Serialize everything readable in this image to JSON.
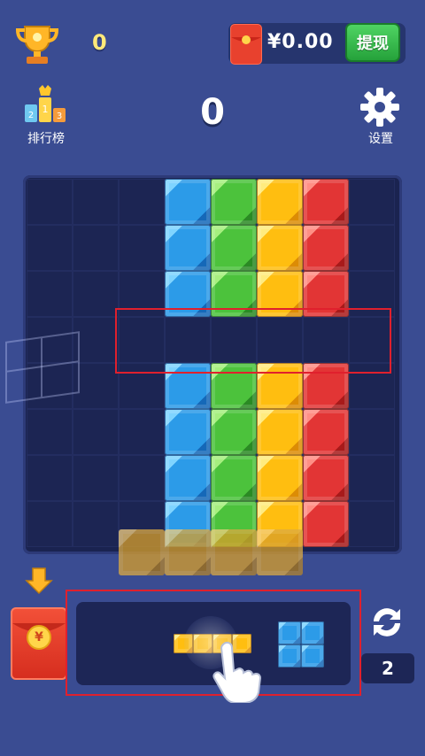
{
  "header": {
    "trophy_score": "0",
    "money": "¥0.00",
    "withdraw_label": "提现",
    "rank_label": "排行榜",
    "center_score": "0",
    "settings_label": "设置"
  },
  "board": {
    "cols": 8,
    "rows": 8,
    "blocks": [
      {
        "c": 3,
        "r": 0,
        "color": "blue"
      },
      {
        "c": 4,
        "r": 0,
        "color": "green"
      },
      {
        "c": 5,
        "r": 0,
        "color": "yellow"
      },
      {
        "c": 6,
        "r": 0,
        "color": "red"
      },
      {
        "c": 3,
        "r": 1,
        "color": "blue"
      },
      {
        "c": 4,
        "r": 1,
        "color": "green"
      },
      {
        "c": 5,
        "r": 1,
        "color": "yellow"
      },
      {
        "c": 6,
        "r": 1,
        "color": "red"
      },
      {
        "c": 3,
        "r": 2,
        "color": "blue"
      },
      {
        "c": 4,
        "r": 2,
        "color": "green"
      },
      {
        "c": 5,
        "r": 2,
        "color": "yellow"
      },
      {
        "c": 6,
        "r": 2,
        "color": "red"
      },
      {
        "c": 3,
        "r": 4,
        "color": "blue"
      },
      {
        "c": 4,
        "r": 4,
        "color": "green"
      },
      {
        "c": 5,
        "r": 4,
        "color": "yellow"
      },
      {
        "c": 6,
        "r": 4,
        "color": "red"
      },
      {
        "c": 3,
        "r": 5,
        "color": "blue"
      },
      {
        "c": 4,
        "r": 5,
        "color": "green"
      },
      {
        "c": 5,
        "r": 5,
        "color": "yellow"
      },
      {
        "c": 6,
        "r": 5,
        "color": "red"
      },
      {
        "c": 3,
        "r": 6,
        "color": "blue"
      },
      {
        "c": 4,
        "r": 6,
        "color": "green"
      },
      {
        "c": 5,
        "r": 6,
        "color": "yellow"
      },
      {
        "c": 6,
        "r": 6,
        "color": "red"
      },
      {
        "c": 3,
        "r": 7,
        "color": "blue"
      },
      {
        "c": 4,
        "r": 7,
        "color": "green"
      },
      {
        "c": 5,
        "r": 7,
        "color": "yellow"
      },
      {
        "c": 6,
        "r": 7,
        "color": "red"
      }
    ],
    "ghost_piece_cols": [
      2,
      3,
      4,
      5
    ],
    "empty_row_highlighted": 3
  },
  "tray": {
    "pieces": [
      {
        "name": "yellow-i-piece",
        "color": "yellow",
        "shape": "1x4"
      },
      {
        "name": "blue-o-piece",
        "color": "blue",
        "shape": "2x2"
      }
    ]
  },
  "controls": {
    "refresh_count": "2"
  },
  "colors": {
    "background": "#3a4c92",
    "board": "#1a2350",
    "accent_green": "#4fd463",
    "highlight_red": "#e0202d"
  }
}
